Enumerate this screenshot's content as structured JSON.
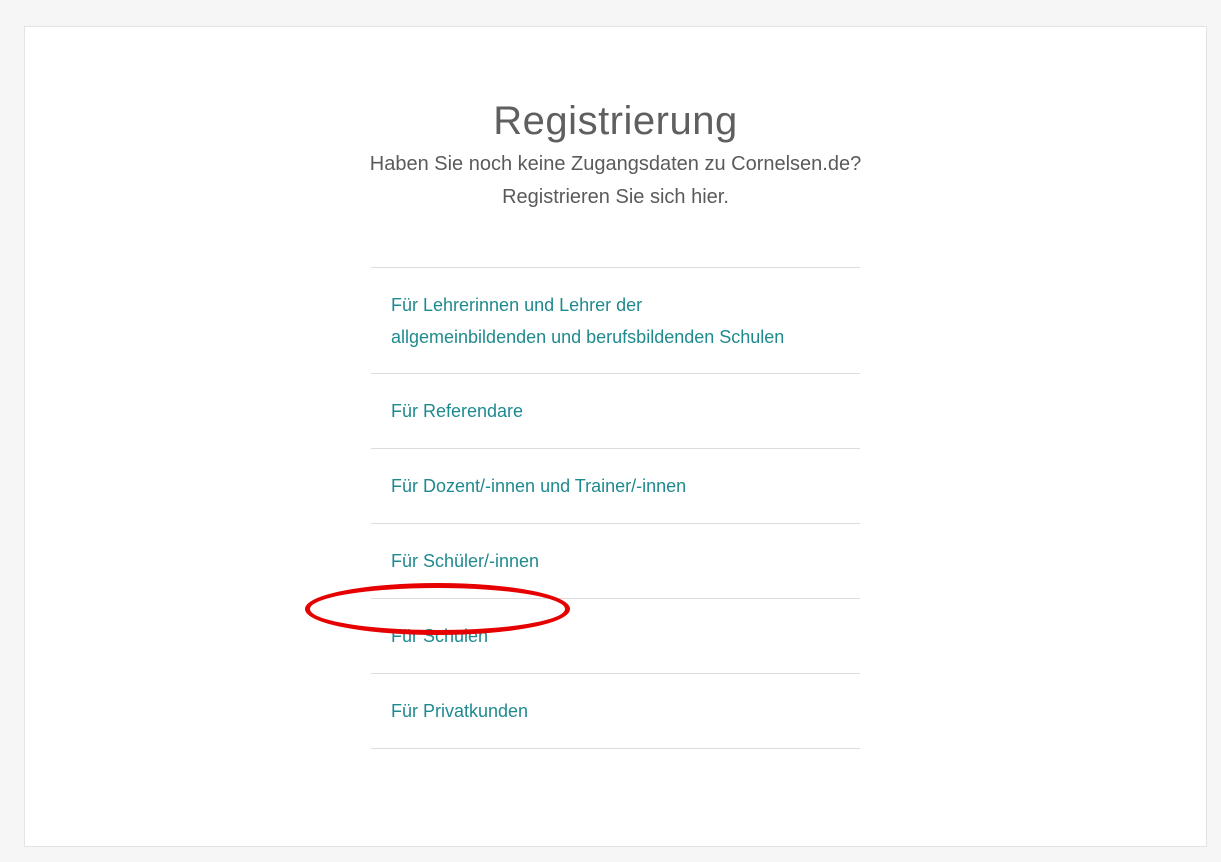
{
  "page": {
    "title": "Registrierung",
    "intro_line1": "Haben Sie noch keine Zugangsdaten zu Cornelsen.de?",
    "intro_line2": "Registrieren Sie sich hier."
  },
  "options": [
    {
      "line1": "Für Lehrerinnen und Lehrer der",
      "line2": "allgemeinbildenden und berufsbildenden Schulen"
    },
    {
      "label": "Für Referendare"
    },
    {
      "label": "Für Dozent/-innen und Trainer/-innen"
    },
    {
      "label": "Für Schüler/-innen"
    },
    {
      "label": "Für Schulen",
      "highlighted": true
    },
    {
      "label": "Für Privatkunden"
    }
  ],
  "colors": {
    "link": "#1f8a8e",
    "highlight": "#e60000"
  }
}
